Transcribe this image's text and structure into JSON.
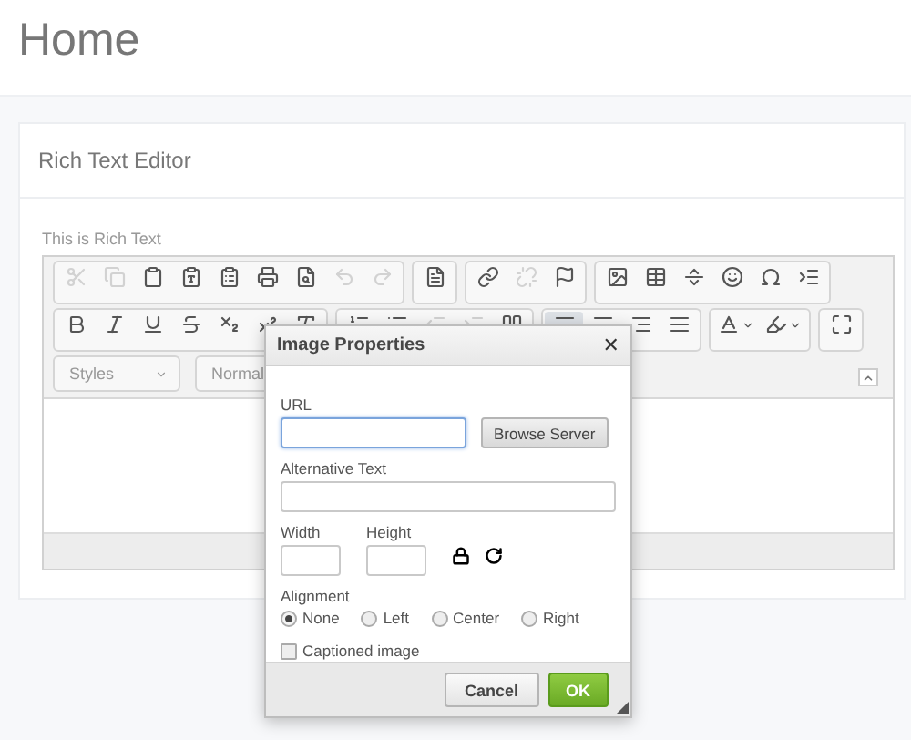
{
  "page": {
    "title": "Home"
  },
  "card": {
    "title": "Rich Text Editor"
  },
  "editor": {
    "label": "This is Rich Text",
    "toolbar_rows": [
      [
        [
          {
            "kind": "cut",
            "disabled": true,
            "active": false
          },
          {
            "kind": "copy",
            "disabled": true,
            "active": false
          },
          {
            "kind": "paste",
            "disabled": false,
            "active": false
          },
          {
            "kind": "pastetext",
            "disabled": false,
            "active": false
          },
          {
            "kind": "pasteword",
            "disabled": false,
            "active": false
          },
          {
            "kind": "print",
            "disabled": false,
            "active": false
          },
          {
            "kind": "preview",
            "disabled": false,
            "active": false
          },
          {
            "kind": "undo",
            "disabled": true,
            "active": false
          },
          {
            "kind": "redo",
            "disabled": true,
            "active": false
          }
        ],
        [
          {
            "kind": "templates",
            "disabled": false,
            "active": false
          }
        ],
        [
          {
            "kind": "link",
            "disabled": false,
            "active": false
          },
          {
            "kind": "unlink",
            "disabled": true,
            "active": false
          },
          {
            "kind": "anchor",
            "disabled": false,
            "active": false
          }
        ],
        [
          {
            "kind": "image",
            "disabled": false,
            "active": false
          },
          {
            "kind": "table",
            "disabled": false,
            "active": false
          },
          {
            "kind": "hline",
            "disabled": false,
            "active": false
          },
          {
            "kind": "smiley",
            "disabled": false,
            "active": false
          },
          {
            "kind": "specialchar",
            "disabled": false,
            "active": false
          },
          {
            "kind": "pagebreak",
            "disabled": false,
            "active": false
          }
        ]
      ],
      [
        [
          {
            "kind": "bold",
            "disabled": false,
            "active": false
          },
          {
            "kind": "italic",
            "disabled": false,
            "active": false
          },
          {
            "kind": "underline",
            "disabled": false,
            "active": false
          },
          {
            "kind": "strike",
            "disabled": false,
            "active": false
          },
          {
            "kind": "subscript",
            "disabled": false,
            "active": false
          },
          {
            "kind": "superscript",
            "disabled": false,
            "active": false
          },
          {
            "kind": "removeformat",
            "disabled": false,
            "active": false
          }
        ],
        [
          {
            "kind": "numberedlist",
            "disabled": false,
            "active": false
          },
          {
            "kind": "bulletedlist",
            "disabled": false,
            "active": false
          },
          {
            "kind": "outdent",
            "disabled": true,
            "active": false
          },
          {
            "kind": "indent",
            "disabled": true,
            "active": false
          },
          {
            "kind": "blockquote",
            "disabled": false,
            "active": false
          }
        ],
        [
          {
            "kind": "alignleft",
            "disabled": false,
            "active": true
          },
          {
            "kind": "aligncenter",
            "disabled": false,
            "active": false
          },
          {
            "kind": "alignright",
            "disabled": false,
            "active": false
          },
          {
            "kind": "justify",
            "disabled": false,
            "active": false
          }
        ],
        [
          {
            "kind": "textcolor",
            "disabled": false,
            "active": false
          },
          {
            "kind": "bgcolor",
            "disabled": false,
            "active": false
          }
        ],
        [
          {
            "kind": "maximize",
            "disabled": false,
            "active": false
          }
        ]
      ]
    ],
    "dropdowns": [
      {
        "label": "Styles",
        "caret": true
      },
      {
        "label": "Normal"
      }
    ]
  },
  "dialog": {
    "title": "Image Properties",
    "close": "✕",
    "url": {
      "label": "URL",
      "focused": true
    },
    "browse_button": "Browse Server",
    "alt": {
      "label": "Alternative Text"
    },
    "width": {
      "label": "Width"
    },
    "height": {
      "label": "Height"
    },
    "alignment": {
      "label": "Alignment",
      "options": [
        {
          "label": "None",
          "selected": true
        },
        {
          "label": "Left",
          "selected": false
        },
        {
          "label": "Center",
          "selected": false
        },
        {
          "label": "Right",
          "selected": false
        }
      ]
    },
    "captioned": {
      "label": "Captioned image",
      "checked": false
    },
    "buttons": [
      {
        "label": "Cancel",
        "kind": "secondary"
      },
      {
        "label": "OK",
        "kind": "primary"
      }
    ]
  }
}
